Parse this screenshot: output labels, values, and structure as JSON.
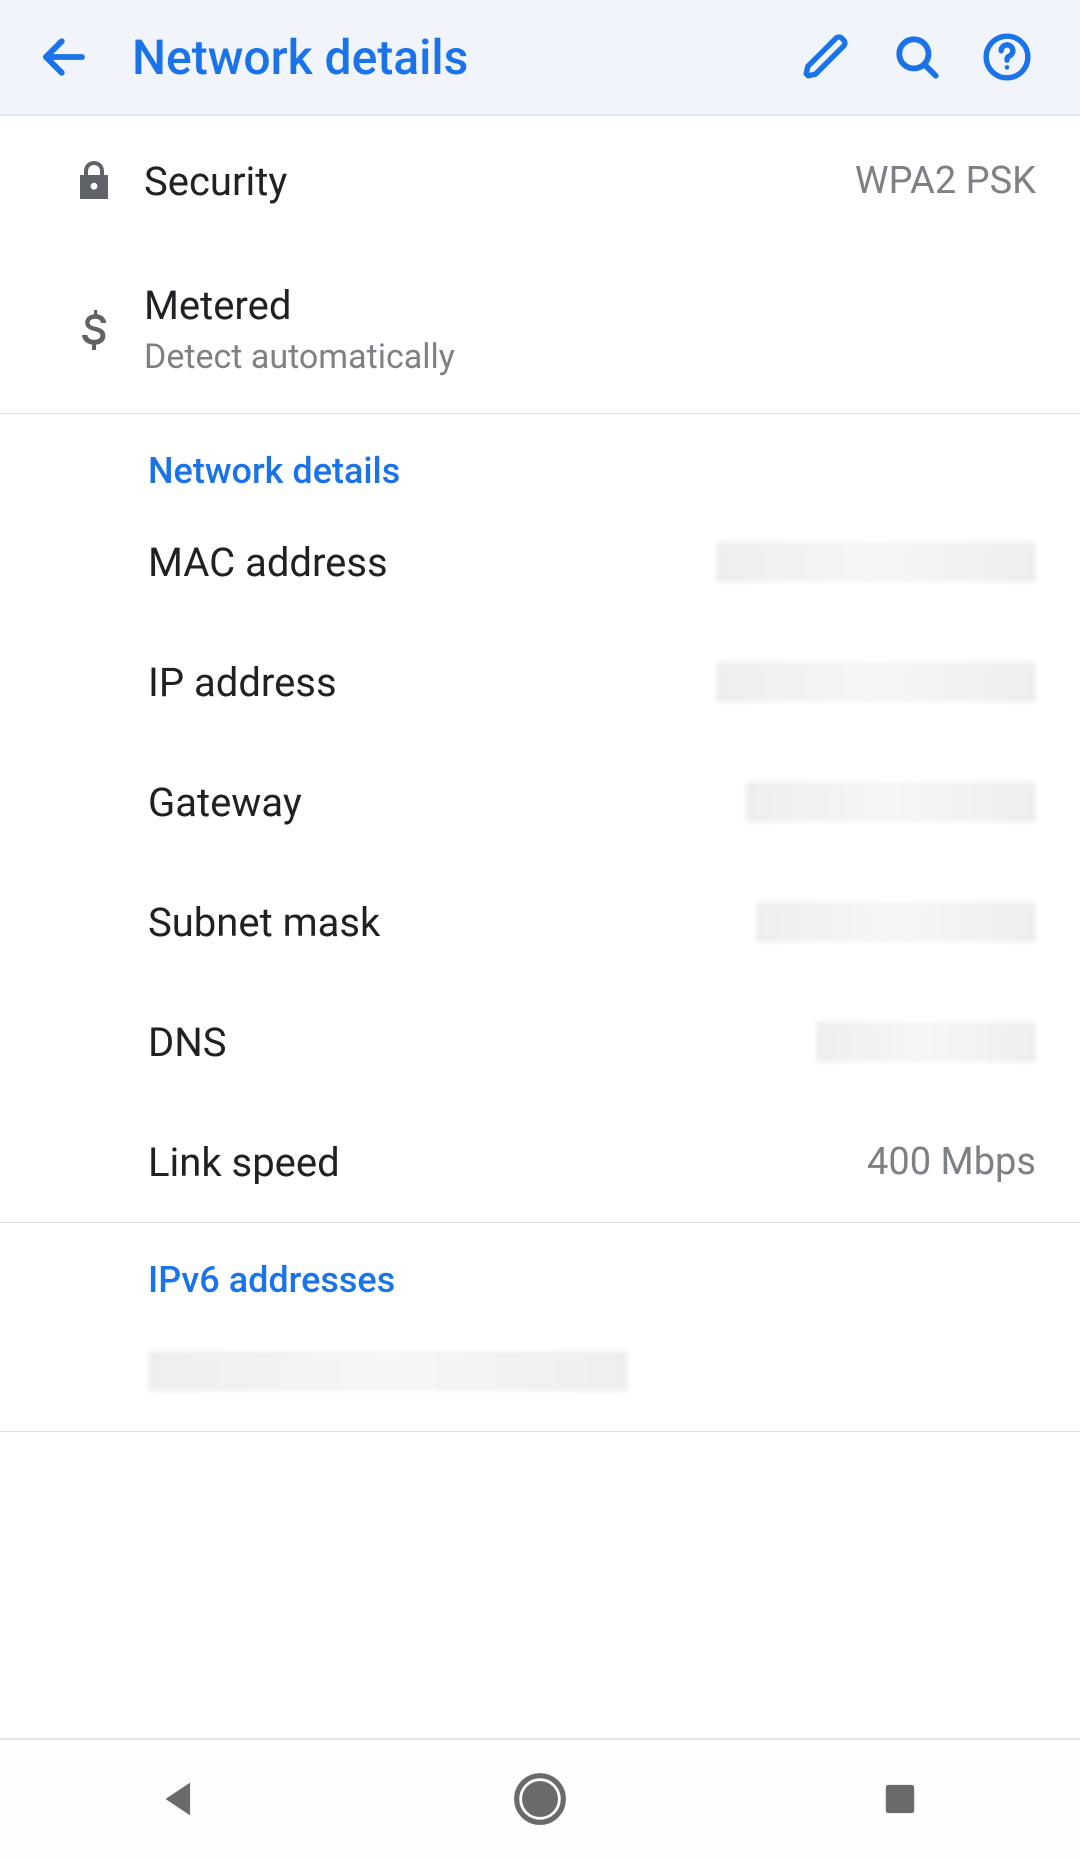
{
  "header": {
    "title": "Network details"
  },
  "rows": {
    "security": {
      "label": "Security",
      "value": "WPA2 PSK"
    },
    "metered": {
      "label": "Metered",
      "secondary": "Detect automatically"
    }
  },
  "sections": {
    "network_details": {
      "title": "Network details",
      "items": {
        "mac": {
          "label": "MAC address"
        },
        "ip": {
          "label": "IP address"
        },
        "gw": {
          "label": "Gateway"
        },
        "sub": {
          "label": "Subnet mask"
        },
        "dns": {
          "label": "DNS"
        },
        "link": {
          "label": "Link speed",
          "value": "400 Mbps"
        }
      }
    },
    "ipv6": {
      "title": "IPv6 addresses"
    }
  }
}
